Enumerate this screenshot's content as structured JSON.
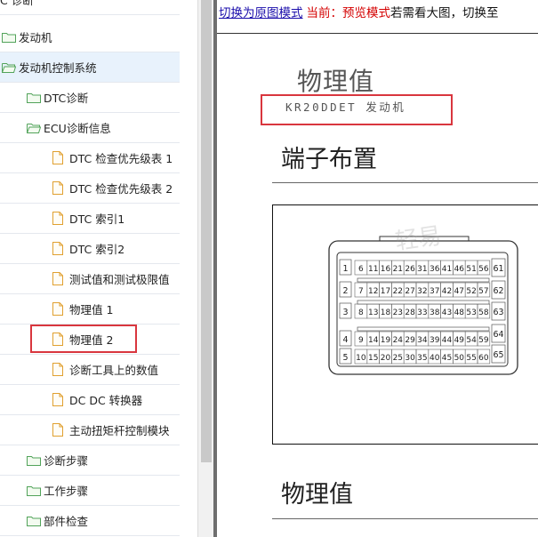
{
  "tree": {
    "items": [
      {
        "label": "C 诊断",
        "icon": "none",
        "level": 0
      },
      {
        "label": "发动机",
        "icon": "folder",
        "level": 0
      },
      {
        "label": "发动机控制系统",
        "icon": "folder-open",
        "level": 0,
        "selected": true
      },
      {
        "label": "DTC诊断",
        "icon": "folder",
        "level": 1
      },
      {
        "label": "ECU诊断信息",
        "icon": "folder-open",
        "level": 1
      },
      {
        "label": "DTC 检查优先级表 1",
        "icon": "document",
        "level": 2
      },
      {
        "label": "DTC 检查优先级表 2",
        "icon": "document",
        "level": 2
      },
      {
        "label": "DTC 索引1",
        "icon": "document",
        "level": 2
      },
      {
        "label": "DTC 索引2",
        "icon": "document",
        "level": 2
      },
      {
        "label": "测试值和测试极限值",
        "icon": "document",
        "level": 2
      },
      {
        "label": "物理值 1",
        "icon": "document",
        "level": 2
      },
      {
        "label": "物理值 2",
        "icon": "document",
        "level": 2,
        "highlighted": true
      },
      {
        "label": "诊断工具上的数值",
        "icon": "document",
        "level": 2
      },
      {
        "label": "DC DC 转换器",
        "icon": "document",
        "level": 2
      },
      {
        "label": "主动扭矩杆控制模块",
        "icon": "document",
        "level": 2
      },
      {
        "label": "诊断步骤",
        "icon": "folder",
        "level": 1
      },
      {
        "label": "工作步骤",
        "icon": "folder",
        "level": 1
      },
      {
        "label": "部件检查",
        "icon": "folder",
        "level": 1
      }
    ]
  },
  "topbar": {
    "switch_link": "切换为原图模式",
    "current_prefix": "当前：",
    "current_mode": "预览模式",
    "tip": "若需看大图，切换至"
  },
  "document": {
    "title": "物理值",
    "subtitle": "KR20DDET 发动机",
    "heading_terminal": "端子布置",
    "heading_physical": "物理值"
  },
  "connector": {
    "left_labels": [
      "1",
      "2",
      "3",
      "4",
      "5"
    ],
    "pin_rows": [
      [
        "6",
        "11",
        "16",
        "21",
        "26",
        "31",
        "36",
        "41",
        "46",
        "51",
        "56"
      ],
      [
        "7",
        "12",
        "17",
        "22",
        "27",
        "32",
        "37",
        "42",
        "47",
        "52",
        "57"
      ],
      [
        "8",
        "13",
        "18",
        "23",
        "28",
        "33",
        "38",
        "43",
        "48",
        "53",
        "58"
      ],
      [
        "9",
        "14",
        "19",
        "24",
        "29",
        "34",
        "39",
        "44",
        "49",
        "54",
        "59"
      ],
      [
        "10",
        "15",
        "20",
        "25",
        "30",
        "35",
        "40",
        "45",
        "50",
        "55",
        "60"
      ]
    ],
    "right_labels": [
      "61",
      "62",
      "63",
      "64",
      "65"
    ]
  },
  "watermark": {
    "text": "轻易"
  },
  "colors": {
    "highlight": "#d9363e",
    "link": "#1a0dab",
    "mode": "#d40000",
    "selected_row": "#e8f2fc"
  }
}
